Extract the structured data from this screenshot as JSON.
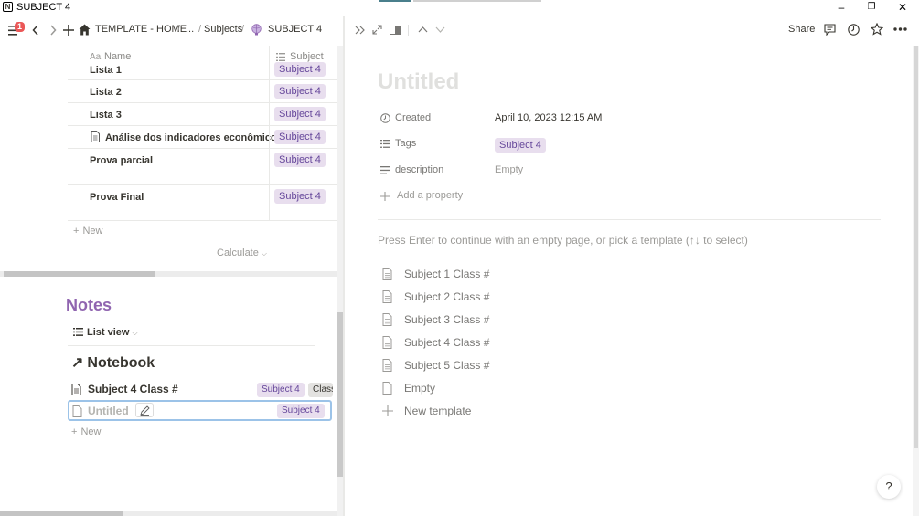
{
  "window": {
    "title": "SUBJECT 4",
    "minimize": "–",
    "restore": "❐",
    "close": "✕"
  },
  "nav": {
    "notification_count": "1",
    "breadcrumbs": [
      "TEMPLATE - HOME",
      "...",
      "Subjects",
      "SUBJECT 4"
    ],
    "separators": [
      "/",
      "/",
      "/"
    ]
  },
  "table": {
    "col_name": "Name",
    "col_subject": "Subject",
    "rows": [
      {
        "name": "Lista 1",
        "tag": "Subject 4"
      },
      {
        "name": "Lista 2",
        "tag": "Subject 4"
      },
      {
        "name": "Lista 3",
        "tag": "Subject 4"
      },
      {
        "name": "Análise dos indicadores econômicos",
        "tag": "Subject 4"
      },
      {
        "name": "Prova parcial",
        "tag": "Subject 4"
      },
      {
        "name": "Prova Final",
        "tag": "Subject 4"
      }
    ],
    "new_label": "New",
    "calculate_label": "Calculate"
  },
  "notes": {
    "title": "Notes",
    "view_label": "List view",
    "notebook_label": "Notebook",
    "items": [
      {
        "title": "Subject 4 Class #",
        "tag": "Subject 4",
        "extra": "Class"
      },
      {
        "title": "Untitled",
        "tag": "Subject 4"
      }
    ],
    "new_label": "New"
  },
  "page": {
    "share_label": "Share",
    "title_placeholder": "Untitled",
    "properties": [
      {
        "label": "Created",
        "value": "April 10, 2023 12:15 AM"
      },
      {
        "label": "Tags",
        "value": "Subject 4"
      },
      {
        "label": "description",
        "value": "Empty"
      }
    ],
    "add_property": "Add a property",
    "hint": "Press Enter to continue with an empty page, or pick a template (↑↓ to select)",
    "templates": [
      "Subject 1 Class #",
      "Subject 2 Class #",
      "Subject 3 Class #",
      "Subject 4 Class #",
      "Subject 5 Class #",
      "Empty"
    ],
    "new_template": "New template",
    "help": "?"
  },
  "colors": {
    "tag_bg": "#e8deee",
    "tag_text": "#65469a",
    "notes_heading": "#9065b0",
    "notif": "#eb5757"
  }
}
